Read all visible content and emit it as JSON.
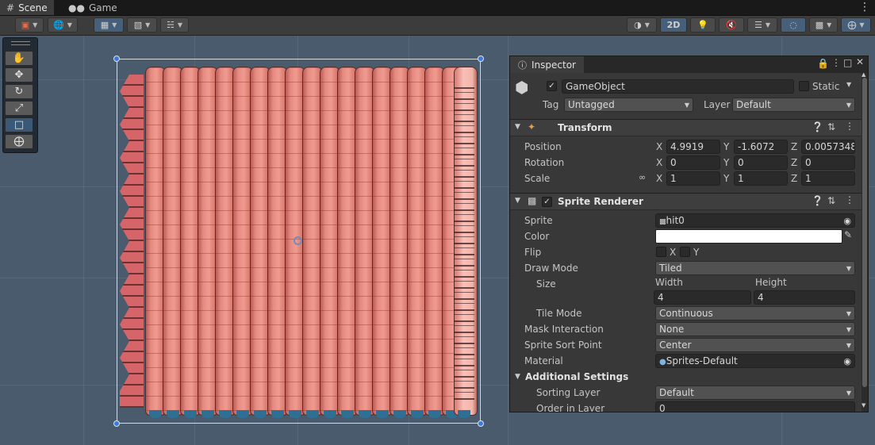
{
  "tabs": [
    {
      "label": "Scene",
      "icon": "grid-icon",
      "active": true
    },
    {
      "label": "Game",
      "icon": "gamepad-icon",
      "active": false
    }
  ],
  "toolbar": {
    "view_2d_label": "2D"
  },
  "inspector": {
    "tab_label": "Inspector",
    "gameobject": {
      "name": "GameObject",
      "active": true,
      "static_label": "Static",
      "tag_label": "Tag",
      "tag_value": "Untagged",
      "layer_label": "Layer",
      "layer_value": "Default"
    },
    "transform": {
      "title": "Transform",
      "position_label": "Position",
      "rotation_label": "Rotation",
      "scale_label": "Scale",
      "axis_x": "X",
      "axis_y": "Y",
      "axis_z": "Z",
      "position": {
        "x": "4.9919",
        "y": "-1.6072",
        "z": "0.0057348"
      },
      "rotation": {
        "x": "0",
        "y": "0",
        "z": "0"
      },
      "scale": {
        "x": "1",
        "y": "1",
        "z": "1"
      }
    },
    "sprite_renderer": {
      "title": "Sprite Renderer",
      "enabled": true,
      "sprite_label": "Sprite",
      "sprite_value": "hit0",
      "color_label": "Color",
      "color_value": "#ffffff",
      "flip_label": "Flip",
      "flip_x": "X",
      "flip_y": "Y",
      "draw_mode_label": "Draw Mode",
      "draw_mode_value": "Tiled",
      "size_label": "Size",
      "width_label": "Width",
      "height_label": "Height",
      "width_value": "4",
      "height_value": "4",
      "tile_mode_label": "Tile Mode",
      "tile_mode_value": "Continuous",
      "mask_label": "Mask Interaction",
      "mask_value": "None",
      "sort_point_label": "Sprite Sort Point",
      "sort_point_value": "Center",
      "material_label": "Material",
      "material_value": "Sprites-Default"
    },
    "additional": {
      "title": "Additional Settings",
      "sorting_layer_label": "Sorting Layer",
      "sorting_layer_value": "Default",
      "order_label": "Order in Layer",
      "order_value": "0"
    }
  },
  "colors": {
    "viewport_bg": "#4a5b6d",
    "selection_handle": "#3a7be0",
    "worm_body": "#f09b90",
    "worm_feet": "#2f6f93"
  }
}
